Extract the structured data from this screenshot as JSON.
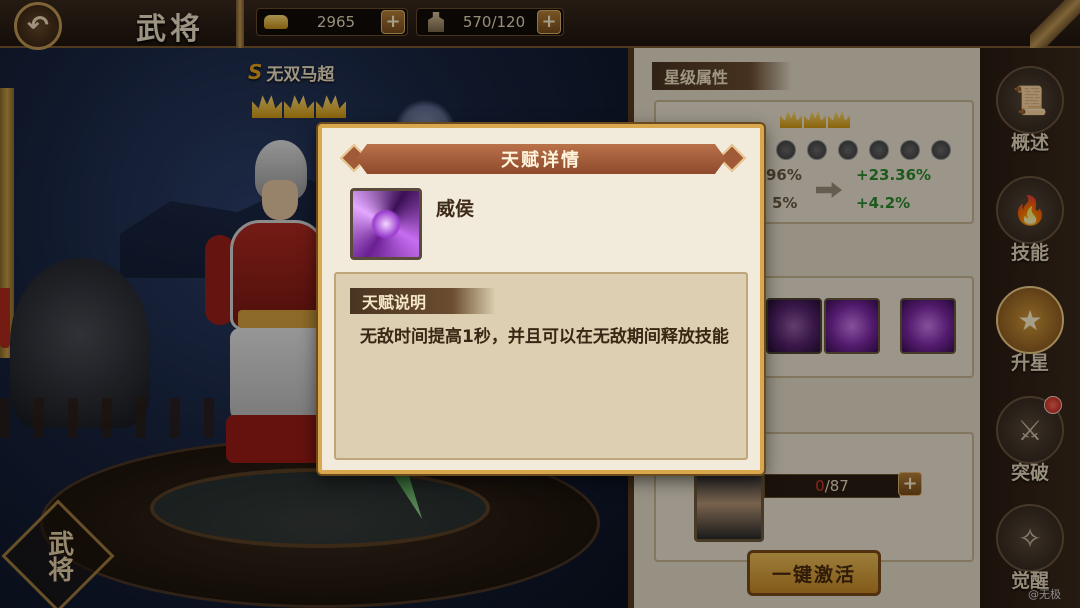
{
  "topbar": {
    "title": "武将",
    "gold": "2965",
    "stamina": "570/120"
  },
  "hero": {
    "rank": "S",
    "name": "无双马超",
    "stars": 3
  },
  "corner_badge": "武将",
  "panel": {
    "star_attributes_header": "星级属性",
    "stars": 3,
    "stat_old_1": "96%",
    "stat_old_2": "5%",
    "stat_new_1": "+23.36%",
    "stat_new_2": "+4.2%",
    "shard_current": "0",
    "shard_total": "/87",
    "activate_button": "一键激活"
  },
  "sidenav": {
    "items": [
      {
        "label": "概述",
        "icon": "scroll-icon"
      },
      {
        "label": "技能",
        "icon": "flame-book-icon"
      },
      {
        "label": "升星",
        "icon": "star-wreath-icon"
      },
      {
        "label": "突破",
        "icon": "sword-burst-icon"
      },
      {
        "label": "觉醒",
        "icon": "meditate-icon"
      }
    ]
  },
  "modal": {
    "title": "天赋详情",
    "talent_name": "威侯",
    "desc_header": "天赋说明",
    "desc_text": "无敌时间提高1秒，并且可以在无敌期间释放技能"
  },
  "watermark": "@无极",
  "colors": {
    "gold": "#d9a74e",
    "positive": "#2f8a2f",
    "alert": "#d23a2a"
  }
}
